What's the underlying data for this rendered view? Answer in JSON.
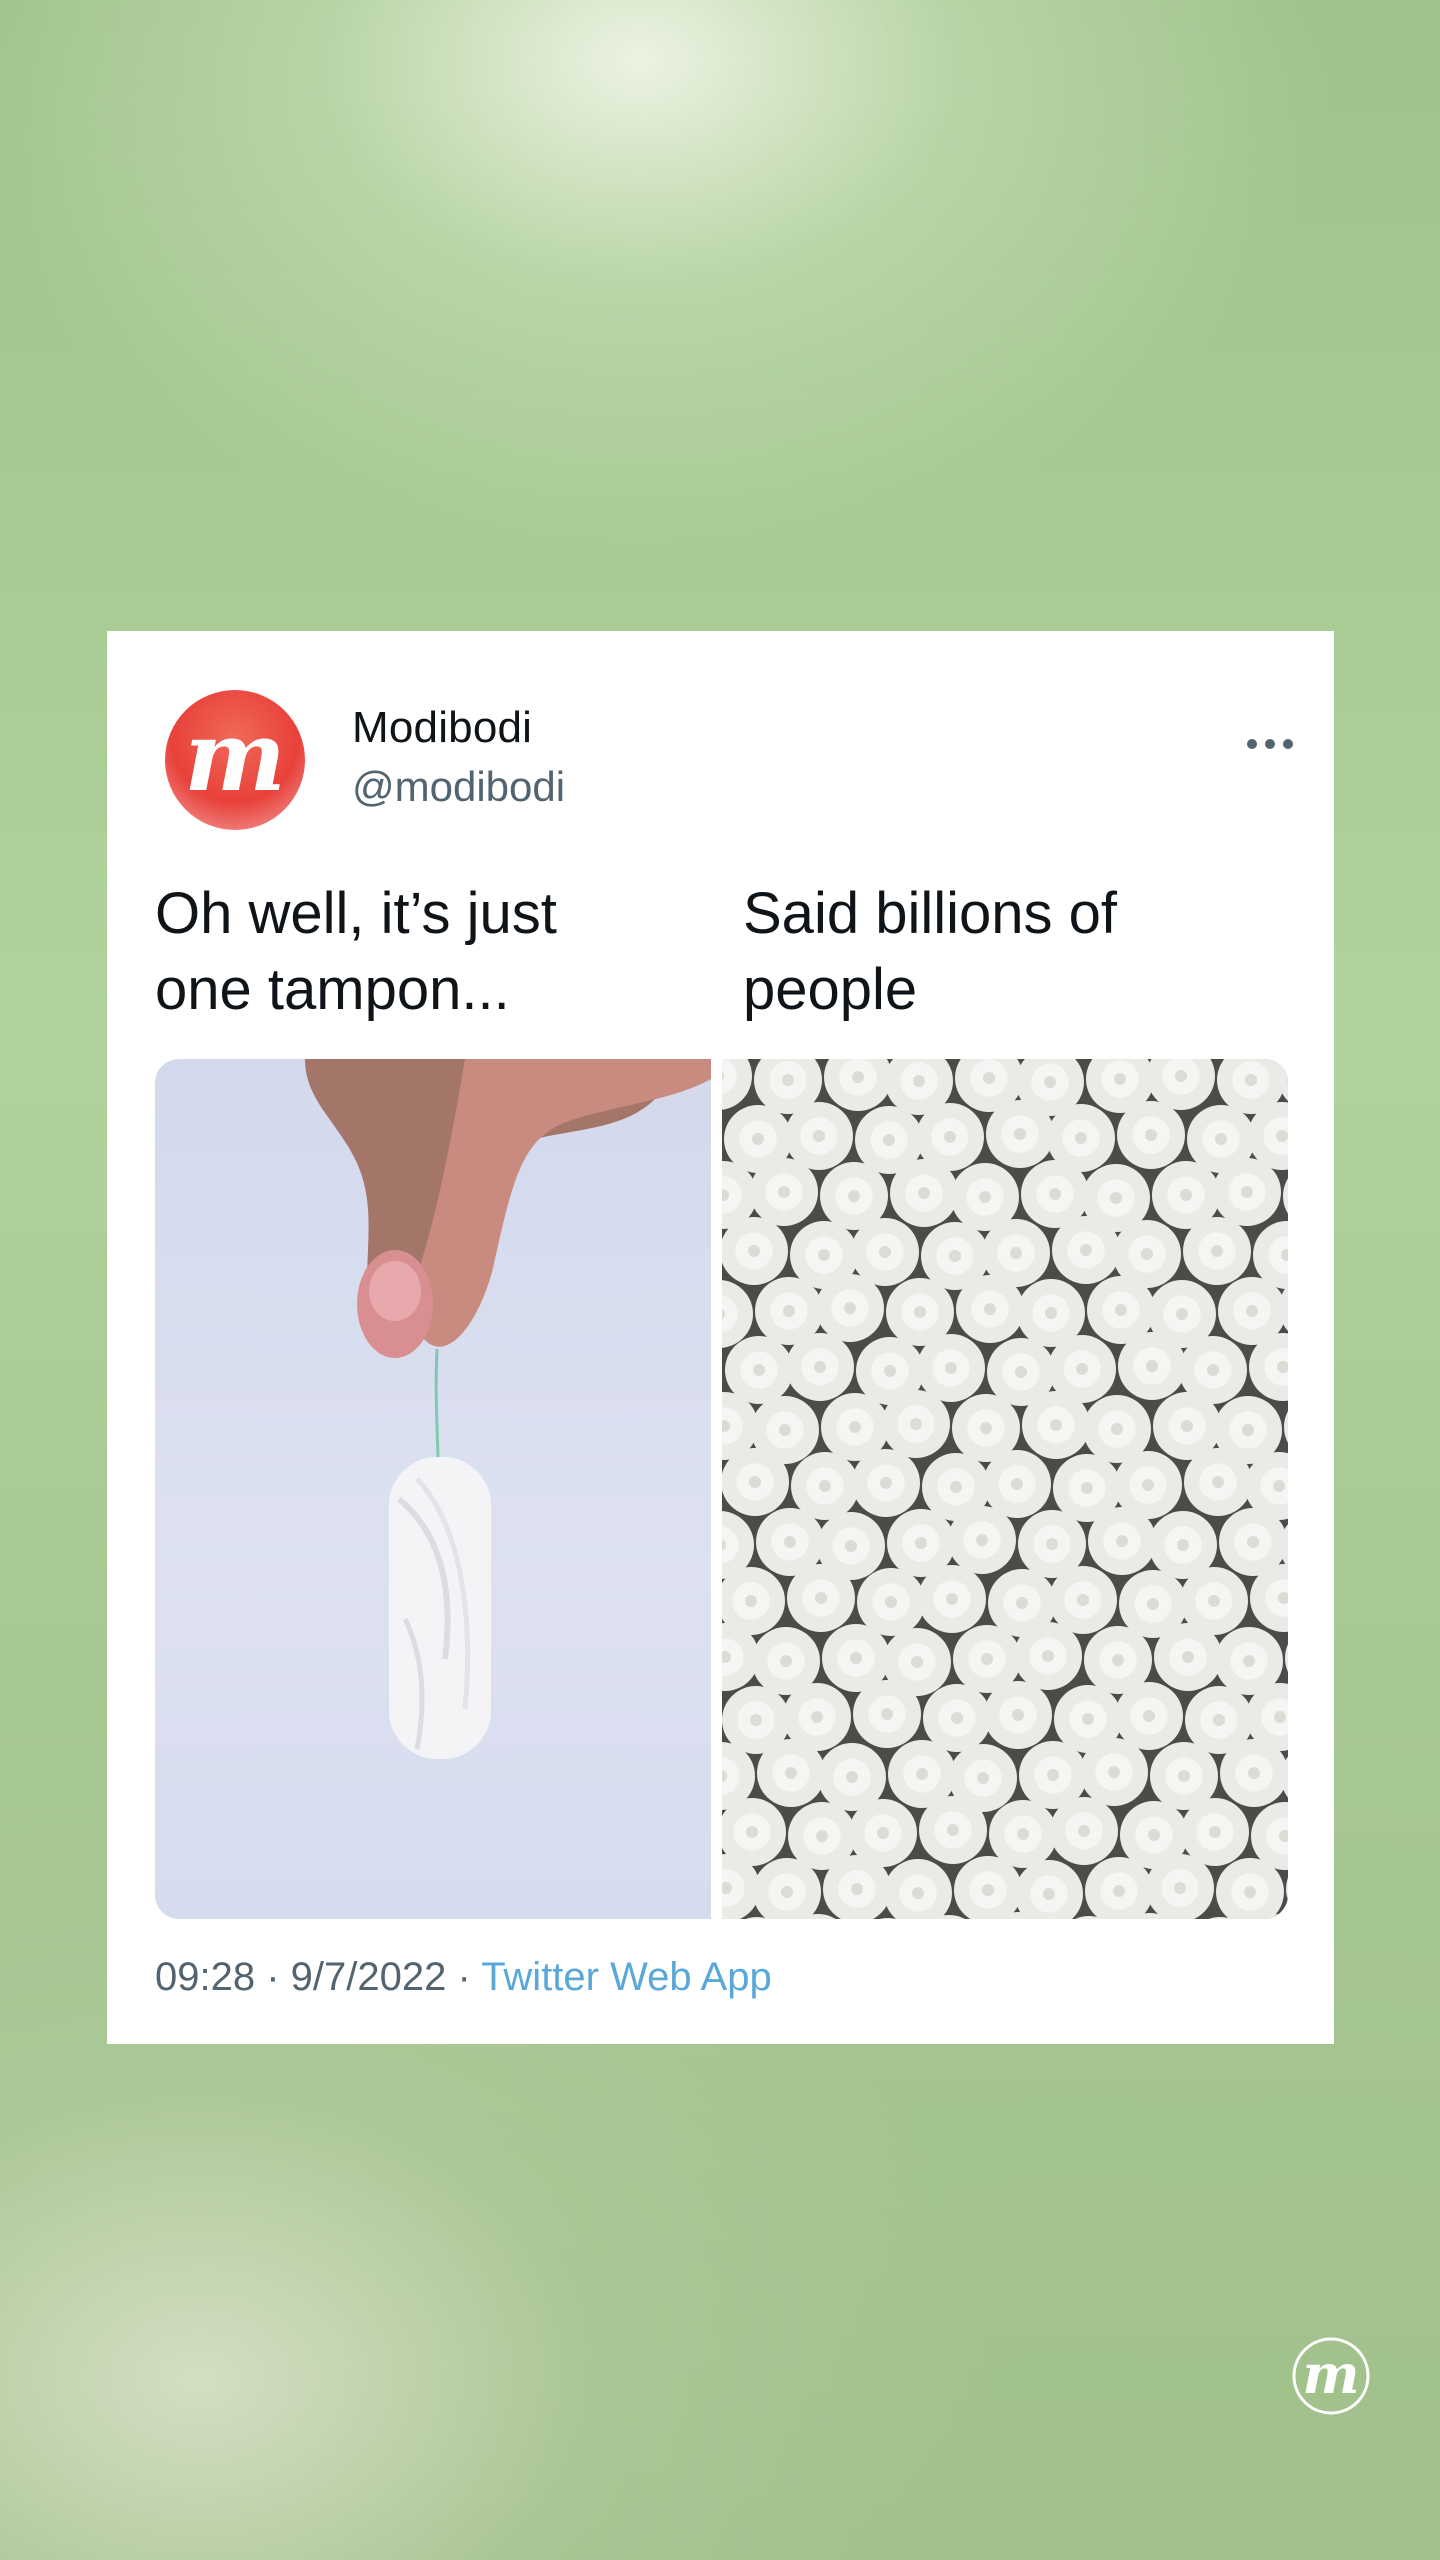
{
  "tweet": {
    "author_name": "Modibodi",
    "author_handle": "@modibodi",
    "avatar_icon": "modibodi-logo-icon",
    "more_icon": "more-options-icon",
    "caption_left": "Oh well, it’s just\none tampon...",
    "caption_right": "Said billions of\npeople",
    "time": "09:28",
    "date": "9/7/2022",
    "separator": " · ",
    "source": "Twitter Web App"
  },
  "images": {
    "left": "tampon-held-by-fingers",
    "right": "pile-of-tampons"
  },
  "colors": {
    "brand_red": "#e8413a",
    "link_blue": "#5aa8d8",
    "background_green": "#a8c893"
  }
}
